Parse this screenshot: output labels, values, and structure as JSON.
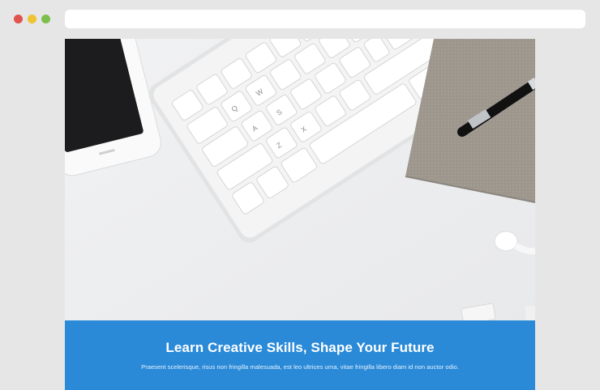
{
  "browser": {
    "window_controls": [
      "close",
      "minimize",
      "maximize"
    ],
    "address_bar": {
      "value": ""
    }
  },
  "hero": {
    "image_subject": "desk-workspace",
    "keyboard_keys": [
      "A",
      "Q",
      "W",
      "Z",
      "S",
      "X"
    ]
  },
  "banner": {
    "title": "Learn Creative Skills, Shape Your Future",
    "subtitle": "Praesent scelerisque, risus non fringilla malesuada, est leo ultrices urna, vitae fringilla libero diam id non auctor odio.",
    "background_color": "#2a8ad8"
  }
}
